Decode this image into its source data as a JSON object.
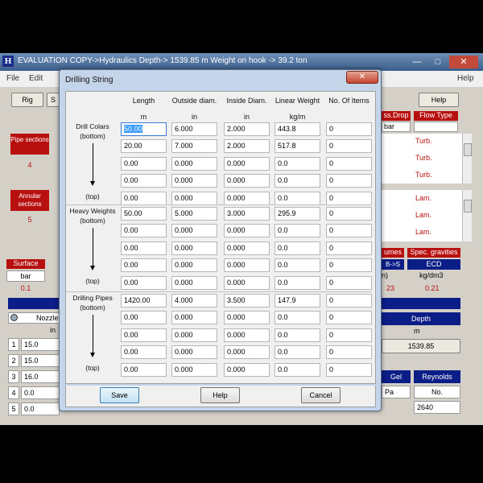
{
  "window": {
    "icon_letter": "H",
    "title": "EVALUATION COPY->Hydraulics      Depth-> 1539.85 m      Weight on hook -> 39.2 ton",
    "minimize": "—",
    "maximize": "□",
    "close": "✕"
  },
  "menu": {
    "file": "File",
    "edit": "Edit",
    "help": "Help"
  },
  "background": {
    "rig_button": "Rig",
    "s_button": "S",
    "help_button": "Help",
    "pipe_sections_label": "Pipe sections",
    "pipe_sections_value": "4",
    "annular_sections_label": "Annular sections",
    "annular_sections_value": "5",
    "press_drop_label": "ss.Drop",
    "press_drop_unit": "bar",
    "flow_type_label": "Flow Type",
    "flow_pipe": [
      "Turb.",
      "Turb.",
      "Turb."
    ],
    "flow_annular": [
      "Lam.",
      "Lam.",
      "Lam."
    ],
    "surface_label": "Surface",
    "surface_unit": "bar",
    "surface_value": "0.1",
    "volumes_label": "umes",
    "spec_gravities_label": "Spec. gravities",
    "b_s_label": "B->S",
    "ecd_label": "ECD",
    "b_s_unit": "n)",
    "ecd_unit": "kg/dm3",
    "b_s_value": "23",
    "ecd_value": "0.21",
    "nozzle_label": "Nozzle",
    "nozzle_unit": "in",
    "nozzle_rows": [
      {
        "num": "1",
        "val": "15.0"
      },
      {
        "num": "2",
        "val": "15.0"
      },
      {
        "num": "3",
        "val": "16.0"
      },
      {
        "num": "4",
        "val": "0.0"
      },
      {
        "num": "5",
        "val": "0.0"
      }
    ],
    "depth_label": "Depth",
    "depth_unit": "m",
    "depth_value": "1539.85",
    "gel_label": "Gel",
    "gel_unit": "Pa",
    "reynolds_label": "Reynolds",
    "reynolds_unit": "No.",
    "reynolds_value": "2640"
  },
  "dialog": {
    "title": "Drilling String",
    "close": "✕",
    "columns": [
      {
        "label": "Length",
        "unit": "m"
      },
      {
        "label": "Outside diam.",
        "unit": "in"
      },
      {
        "label": "Inside Diam.",
        "unit": "in"
      },
      {
        "label": "Linear Weight",
        "unit": "kg/m"
      },
      {
        "label": "No. Of Items",
        "unit": ""
      }
    ],
    "groups": [
      {
        "name": "Drill Colars",
        "bottom": "(bottom)",
        "top": "(top)",
        "rows": [
          [
            "50.00",
            "6.000",
            "2.000",
            "443.8",
            "0"
          ],
          [
            "20.00",
            "7.000",
            "2.000",
            "517.8",
            "0"
          ],
          [
            "0.00",
            "0.000",
            "0.000",
            "0.0",
            "0"
          ],
          [
            "0.00",
            "0.000",
            "0.000",
            "0.0",
            "0"
          ],
          [
            "0.00",
            "0.000",
            "0.000",
            "0.0",
            "0"
          ]
        ]
      },
      {
        "name": "Heavy Weights",
        "bottom": "(bottom)",
        "top": "(top)",
        "rows": [
          [
            "50.00",
            "5.000",
            "3.000",
            "295.9",
            "0"
          ],
          [
            "0.00",
            "0.000",
            "0.000",
            "0.0",
            "0"
          ],
          [
            "0.00",
            "0.000",
            "0.000",
            "0.0",
            "0"
          ],
          [
            "0.00",
            "0.000",
            "0.000",
            "0.0",
            "0"
          ],
          [
            "0.00",
            "0.000",
            "0.000",
            "0.0",
            "0"
          ]
        ]
      },
      {
        "name": "Drilling Pipes",
        "bottom": "(bottom)",
        "top": "(top)",
        "rows": [
          [
            "1420.00",
            "4.000",
            "3.500",
            "147.9",
            "0"
          ],
          [
            "0.00",
            "0.000",
            "0.000",
            "0.0",
            "0"
          ],
          [
            "0.00",
            "0.000",
            "0.000",
            "0.0",
            "0"
          ],
          [
            "0.00",
            "0.000",
            "0.000",
            "0.0",
            "0"
          ],
          [
            "0.00",
            "0.000",
            "0.000",
            "0.0",
            "0"
          ]
        ]
      }
    ],
    "buttons": {
      "save": "Save",
      "help": "Help",
      "cancel": "Cancel"
    }
  }
}
